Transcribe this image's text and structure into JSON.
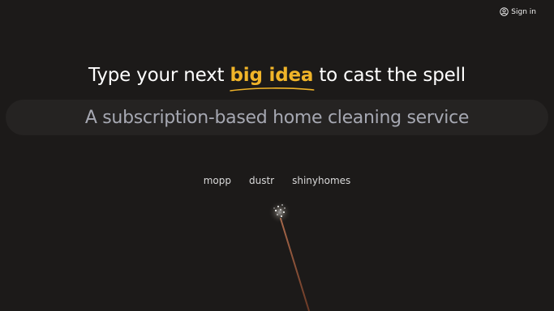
{
  "header": {
    "signin_label": "Sign in"
  },
  "hero": {
    "prefix": "Type your next",
    "accent": "big idea",
    "suffix": "to cast the spell",
    "accent_color": "#f0b429"
  },
  "input": {
    "value": "A subscription-based home cleaning service"
  },
  "suggestions": [
    "mopp",
    "dustr",
    "shinyhomes"
  ],
  "icons": {
    "signin": "user-circle-icon",
    "wand": "magic-wand-icon"
  }
}
